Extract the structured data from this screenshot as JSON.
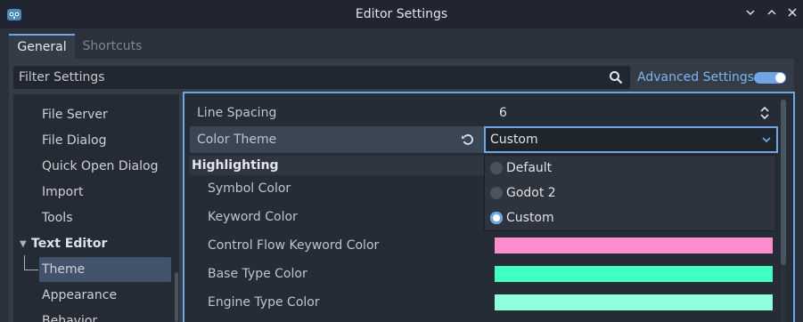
{
  "window": {
    "title": "Editor Settings",
    "colors": {
      "accent": "#6fa6e3"
    }
  },
  "tabs": [
    {
      "label": "General"
    },
    {
      "label": "Shortcuts"
    }
  ],
  "filter": {
    "placeholder": "Filter Settings"
  },
  "advanced": {
    "label": "Advanced Settings",
    "enabled": true
  },
  "tree": {
    "items": [
      {
        "label": "File Server"
      },
      {
        "label": "File Dialog"
      },
      {
        "label": "Quick Open Dialog"
      },
      {
        "label": "Import"
      },
      {
        "label": "Tools"
      }
    ],
    "section": {
      "label": "Text Editor"
    },
    "sub_items": [
      {
        "label": "Theme"
      },
      {
        "label": "Appearance"
      },
      {
        "label": "Behavior"
      }
    ]
  },
  "inspector": {
    "line_spacing": {
      "label": "Line Spacing",
      "value": "6"
    },
    "color_theme": {
      "label": "Color Theme",
      "value": "Custom",
      "options": [
        {
          "label": "Default",
          "selected": false
        },
        {
          "label": "Godot 2",
          "selected": false
        },
        {
          "label": "Custom",
          "selected": true
        }
      ]
    },
    "section": "Highlighting",
    "colors": [
      {
        "label": "Symbol Color",
        "color": ""
      },
      {
        "label": "Keyword Color",
        "color": ""
      },
      {
        "label": "Control Flow Keyword Color",
        "color": "#ff8ccc"
      },
      {
        "label": "Base Type Color",
        "color": "#42ffc2"
      },
      {
        "label": "Engine Type Color",
        "color": "#8fffdb"
      }
    ]
  }
}
